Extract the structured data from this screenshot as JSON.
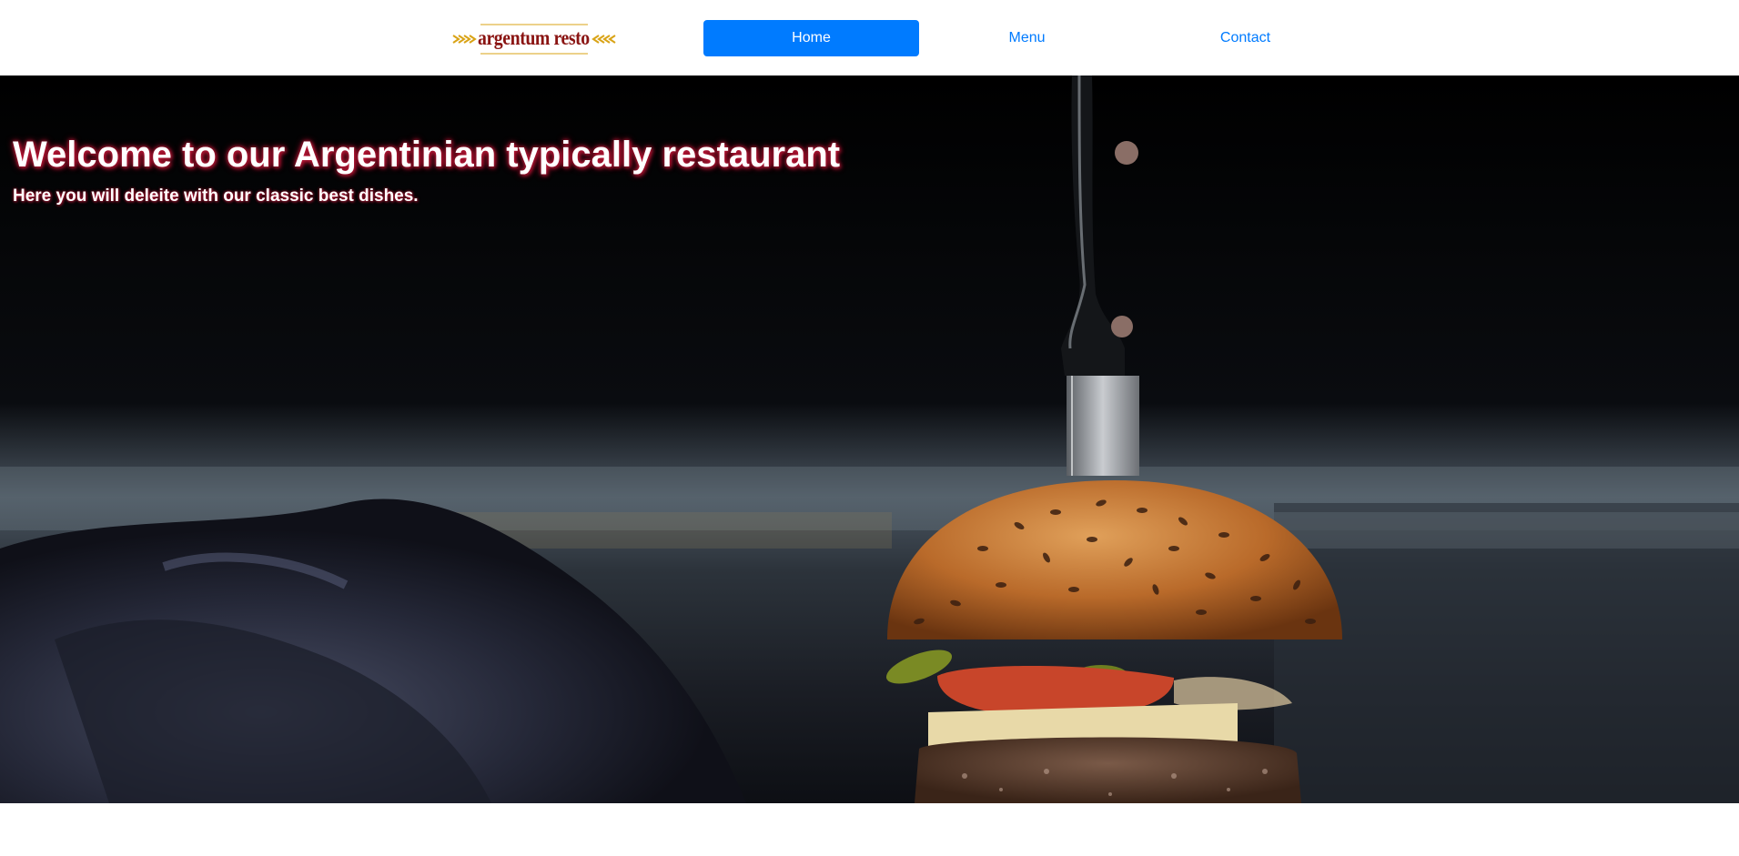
{
  "brand": {
    "logo_text": "argentum resto"
  },
  "nav": {
    "items": [
      {
        "label": "Home",
        "active": true
      },
      {
        "label": "Menu",
        "active": false
      },
      {
        "label": "Contact",
        "active": false
      }
    ]
  },
  "hero": {
    "title": "Welcome to our Argentinian typically restaurant",
    "subtitle": "Here you will deleite with our classic best dishes.",
    "background_image": "burger-with-knife-photo"
  },
  "colors": {
    "link": "#007bff",
    "active_bg": "#007bff",
    "logo_red": "#8a1412",
    "logo_gold": "#d9a316",
    "title_glow": "#c01838"
  }
}
